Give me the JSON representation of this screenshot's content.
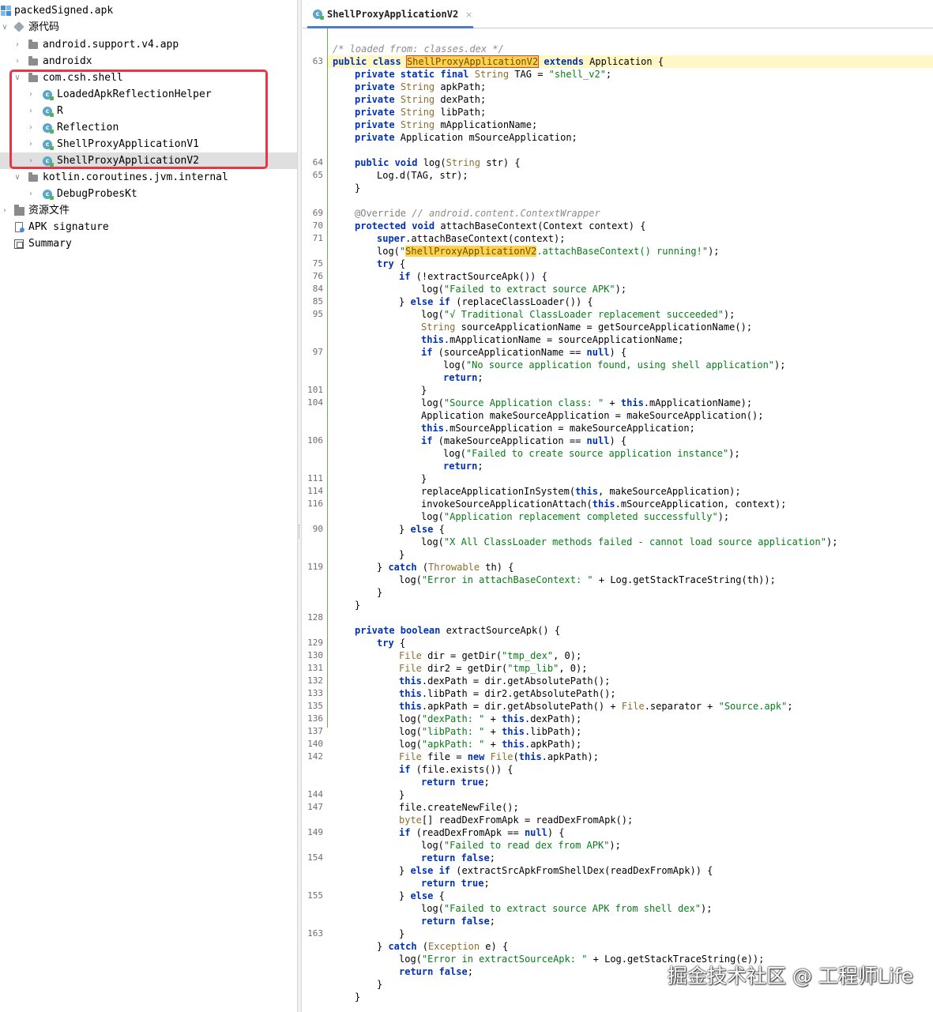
{
  "tree": {
    "root": "packedSigned.apk",
    "source_node": "源代码",
    "pkg_support": "android.support.v4.app",
    "pkg_androidx": "androidx",
    "pkg_shell": "com.csh.shell",
    "class_loaded": "LoadedApkReflectionHelper",
    "class_r": "R",
    "class_reflection": "Reflection",
    "class_v1": "ShellProxyApplicationV1",
    "class_v2": "ShellProxyApplicationV2",
    "pkg_kotlin": "kotlin.coroutines.jvm.internal",
    "class_debug": "DebugProbesKt",
    "resources_node": "资源文件",
    "apk_signature": "APK signature",
    "summary": "Summary"
  },
  "editor": {
    "tab_label": "ShellProxyApplicationV2",
    "tab_close": "×",
    "line_numbers": [
      "",
      "63",
      "",
      "",
      "",
      "",
      "",
      "",
      "",
      "64",
      "65",
      "",
      "",
      "69",
      "70",
      "71",
      "",
      "75",
      "76",
      "84",
      "85",
      "95",
      "",
      "",
      "97",
      "",
      "",
      "101",
      "104",
      "",
      "",
      "106",
      "",
      "",
      "111",
      "114",
      "116",
      "",
      "90",
      "",
      "",
      "119",
      "",
      "",
      "",
      "128",
      "",
      "129",
      "130",
      "131",
      "132",
      "133",
      "135",
      "136",
      "137",
      "140",
      "142",
      "",
      "",
      "144",
      "147",
      "",
      "149",
      "",
      "154",
      "",
      "",
      "155",
      "",
      "",
      "163",
      "",
      ""
    ]
  },
  "watermark": "掘金技术社区 @ 工程师Life",
  "colors": {
    "highlight_box": "#e03a4a",
    "current_line": "#fff8c6",
    "keyword": "#0033b3",
    "string": "#067d17",
    "selected_row": "#dfdfdf"
  }
}
